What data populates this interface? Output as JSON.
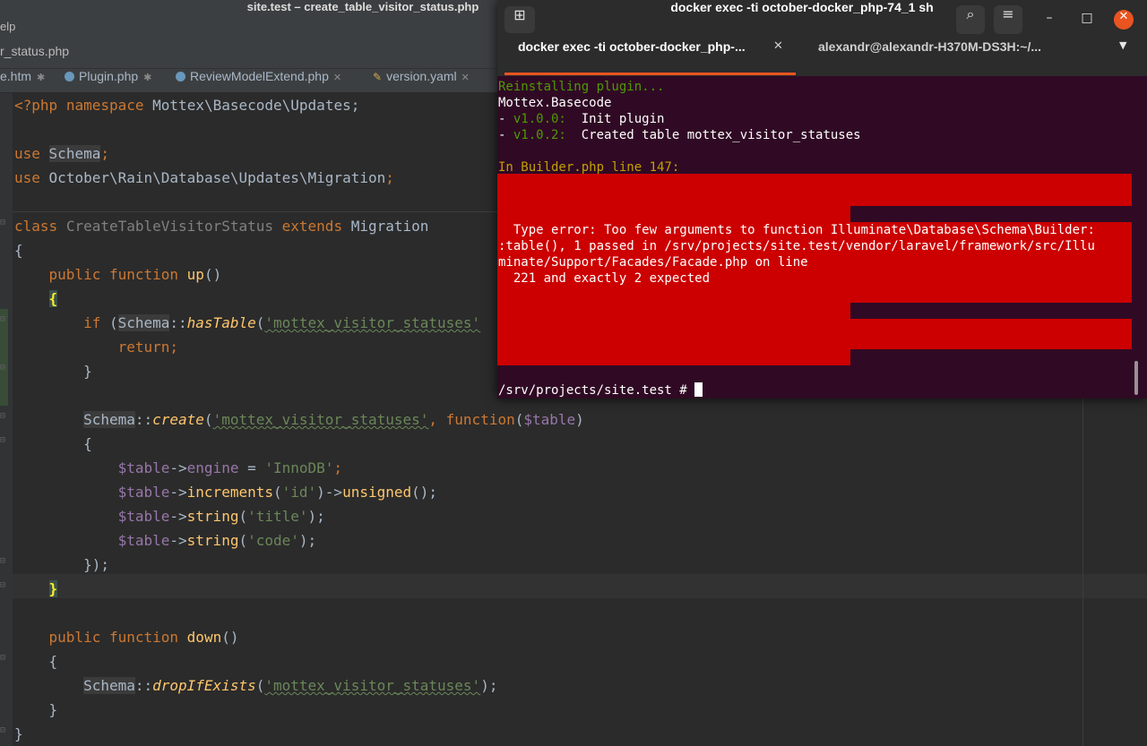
{
  "ide": {
    "title": "site.test – create_table_visitor_status.php",
    "menu_help": "elp",
    "breadcrumb": "r_status.php",
    "tabs": [
      {
        "label": "e.htm",
        "icon": "htm-file-icon"
      },
      {
        "label": "Plugin.php",
        "icon": "php-class-icon"
      },
      {
        "label": "ReviewModelExtend.php",
        "icon": "php-class-icon"
      },
      {
        "label": "version.yaml",
        "icon": "yaml-file-icon"
      }
    ],
    "code": {
      "l1_tag": "<?php",
      "l1_kw": "namespace",
      "l1_ns": "Mottex\\Basecode\\Updates;",
      "l2_kw": "use",
      "l2_cls": "Schema",
      "l2_end": ";",
      "l3_kw": "use",
      "l3_ns": "October\\Rain\\Database\\Updates\\Migration",
      "l3_end": ";",
      "l4_kw": "class",
      "l4_name": "CreateTableVisitorStatus",
      "l4_ext": "extends",
      "l4_parent": "Migration",
      "l5": "{",
      "l6_kw": "public function",
      "l6_fn": "up",
      "l6_end": "()",
      "l7": "{",
      "l8_kw": "if",
      "l8_open": " (",
      "l8_cls": "Schema",
      "l8_op": "::",
      "l8_fn": "hasTable",
      "l8_p": "(",
      "l8_str": "'mottex_visitor_statuses'",
      "l9_kw": "return",
      "l9_end": ";",
      "l10": "}",
      "l11_cls": "Schema",
      "l11_op": "::",
      "l11_fn": "create",
      "l11_p": "(",
      "l11_str": "'mottex_visitor_statuses'",
      "l11_comma": ", ",
      "l11_kw": "function",
      "l11_p2": "(",
      "l11_var": "$table",
      "l11_end": ")",
      "l12": "{",
      "l13_var": "$table",
      "l13_arrow": "->",
      "l13_prop": "engine",
      "l13_eq": " = ",
      "l13_str": "'InnoDB'",
      "l13_end": ";",
      "l14_var": "$table",
      "l14_arrow": "->",
      "l14_m1": "increments",
      "l14_p": "(",
      "l14_str": "'id'",
      "l14_p2": ")->",
      "l14_m2": "unsigned",
      "l14_end": "();",
      "l15_var": "$table",
      "l15_arrow": "->",
      "l15_m": "string",
      "l15_p": "(",
      "l15_str": "'title'",
      "l15_end": ");",
      "l16_var": "$table",
      "l16_arrow": "->",
      "l16_m": "string",
      "l16_p": "(",
      "l16_str": "'code'",
      "l16_end": ");",
      "l17": "});",
      "l18": "}",
      "l19_kw": "public function",
      "l19_fn": "down",
      "l19_end": "()",
      "l20": "{",
      "l21_cls": "Schema",
      "l21_op": "::",
      "l21_fn": "dropIfExists",
      "l21_p": "(",
      "l21_str": "'mottex_visitor_statuses'",
      "l21_end": ");",
      "l22": "}",
      "l23": "}"
    }
  },
  "terminal": {
    "title": "docker exec -ti october-docker_php-74_1 sh",
    "tabs": [
      {
        "label": "docker exec -ti october-docker_php-...",
        "active": true
      },
      {
        "label": "alexandr@alexandr-H370M-DS3H:~/...",
        "active": false
      }
    ],
    "lines": {
      "reinstall": "Reinstalling plugin...",
      "plugin": "Mottex.Basecode",
      "v1_dash": "- ",
      "v1_ver": "v1.0.0:",
      "v1_msg": "  Init plugin",
      "v2_dash": "- ",
      "v2_ver": "v1.0.2:",
      "v2_msg": "  Created table mottex_visitor_statuses",
      "in_builder": "In Builder.php line 147:",
      "err1": "  Type error: Too few arguments to function Illuminate\\Database\\Schema\\Builder:",
      "err2": ":table(), 1 passed in /srv/projects/site.test/vendor/laravel/framework/src/Illu",
      "err3": "minate/Support/Facades/Facade.php on line",
      "err4": "  221 and exactly 2 expected",
      "prompt": "/srv/projects/site.test # "
    },
    "colors": {
      "background": "#300a24",
      "error_bg": "#cc0000",
      "accent": "#e95420",
      "green": "#4e9a06",
      "orange": "#c4a000"
    }
  }
}
